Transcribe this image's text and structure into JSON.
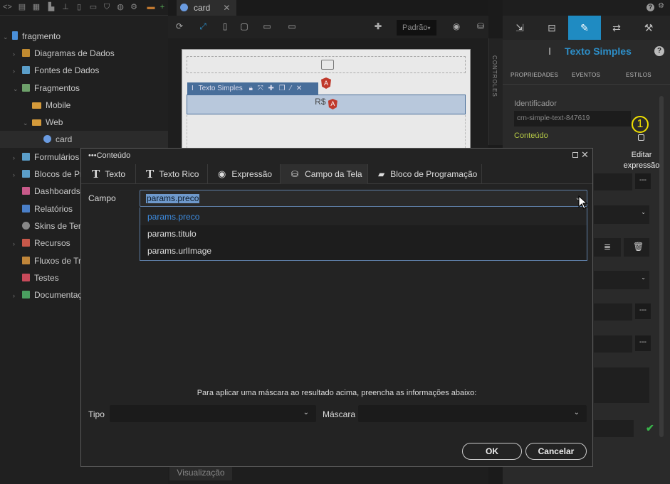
{
  "left_tree": {
    "root": "fragmento",
    "items": [
      {
        "label": "Diagramas de Dados"
      },
      {
        "label": "Fontes de Dados"
      },
      {
        "label": "Fragmentos"
      },
      {
        "label": "Mobile"
      },
      {
        "label": "Web"
      },
      {
        "label": "card"
      },
      {
        "label": "Formulários"
      },
      {
        "label": "Blocos de Pro"
      },
      {
        "label": "Dashboards"
      },
      {
        "label": "Relatórios"
      },
      {
        "label": "Skins de Tem"
      },
      {
        "label": "Recursos"
      },
      {
        "label": "Fluxos de Tra"
      },
      {
        "label": "Testes"
      },
      {
        "label": "Documentação"
      }
    ]
  },
  "editor": {
    "tab": "card",
    "view_mode": "Padrão",
    "controls_label": "CONTROLES",
    "element_label": "Texto Simples",
    "price_text": "R$",
    "bottom_tab": "Visualização"
  },
  "properties": {
    "title": "Texto Simples",
    "tabs": [
      "PROPRIEDADES",
      "EVENTOS",
      "ESTILOS"
    ],
    "identifier_label": "Identificador",
    "identifier_value": "crn-simple-text-847619",
    "content_label": "Conteúdo",
    "badge": "1",
    "edit_expression": "Editar expressão",
    "help": "?"
  },
  "dialog": {
    "title": "Conteúdo",
    "tabs": [
      "Texto",
      "Texto Rico",
      "Expressão",
      "Campo da Tela",
      "Bloco de Programação"
    ],
    "active_tab": "Campo da Tela",
    "field_label": "Campo",
    "field_value": "params.preco",
    "options": [
      "params.preco",
      "params.titulo",
      "params.urlImage"
    ],
    "mask_info": "Para aplicar uma máscara ao resultado acima, preencha as informações abaixo:",
    "type_label": "Tipo",
    "mask_label": "Máscara",
    "ok": "OK",
    "cancel": "Cancelar"
  },
  "colors": {
    "accent": "#1f8bc2",
    "selection": "#6e99cc",
    "option_active": "#3d8bdf",
    "badge": "#f0e000",
    "content_label": "#b5c946"
  }
}
